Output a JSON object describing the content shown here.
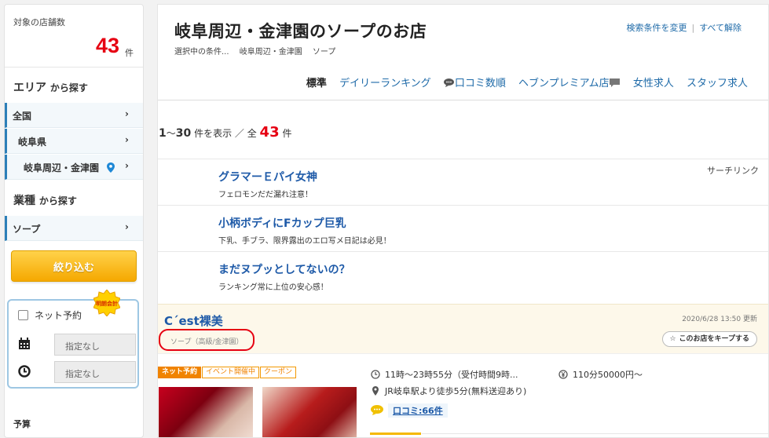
{
  "sidebar": {
    "count_label": "対象の店舗数",
    "count": "43",
    "count_unit": "件",
    "area_heading": "エリア",
    "area_suffix": "から探す",
    "area_items": [
      {
        "label": "全国"
      },
      {
        "label": "岐阜県"
      },
      {
        "label": "岐阜周辺・金津園"
      }
    ],
    "genre_heading": "業種",
    "genre_suffix": "から探す",
    "genre_items": [
      {
        "label": "ソープ"
      }
    ],
    "filter_button": "絞り込む",
    "reserve_label": "ネット予約",
    "reserve_badge": "明朗会計",
    "date_value": "指定なし",
    "time_value": "指定なし",
    "budget_label": "予算"
  },
  "header": {
    "title": "岐阜周辺・金津園のソープのお店",
    "crumbs": [
      "選択中の条件...",
      "岐阜周辺・金津園",
      "ソープ"
    ],
    "change_link": "検索条件を変更",
    "clear_link": "すべて解除",
    "tabs": [
      {
        "label": "標準",
        "active": true
      },
      {
        "label": "デイリーランキング"
      },
      {
        "label": "口コミ数順"
      },
      {
        "label": "ヘブンプレミアム店"
      },
      {
        "label": "女性求人"
      },
      {
        "label": "スタッフ求人"
      }
    ]
  },
  "results": {
    "start": "1",
    "end": "30",
    "mid_text": "件を表示 ／ 全",
    "total": "43",
    "unit": "件"
  },
  "search_link": "サーチリンク",
  "sponsors": [
    {
      "title": "グラマーＥパイ女神",
      "subtitle": "フェロモンだだ漏れ注意！"
    },
    {
      "title": "小柄ボディにFカップ巨乳",
      "subtitle": "下乳、手ブラ、限界露出のエロ写メ日記は必見！"
    },
    {
      "title": "まだヌプッとしてないの？",
      "subtitle": "ランキング常に上位の安心感！"
    }
  ],
  "shop": {
    "name": "C´est裸美",
    "genre": "ソープ（高級/金津園）",
    "updated": "2020/6/28 13:50 更新",
    "keep_label": "このお店をキープする",
    "tags": [
      "ネット予約",
      "イベント開催中",
      "クーポン"
    ],
    "hours": "11時～23時55分（受付時間9時...",
    "price": "110分50000円～",
    "access": "JR岐阜駅より徒歩5分(無料送迎あり)",
    "reviews": "口コミ:66件"
  },
  "colors": {
    "accent_red": "#e60012",
    "link_blue": "#1e6aa8",
    "button_yellow": "#f5a800"
  }
}
